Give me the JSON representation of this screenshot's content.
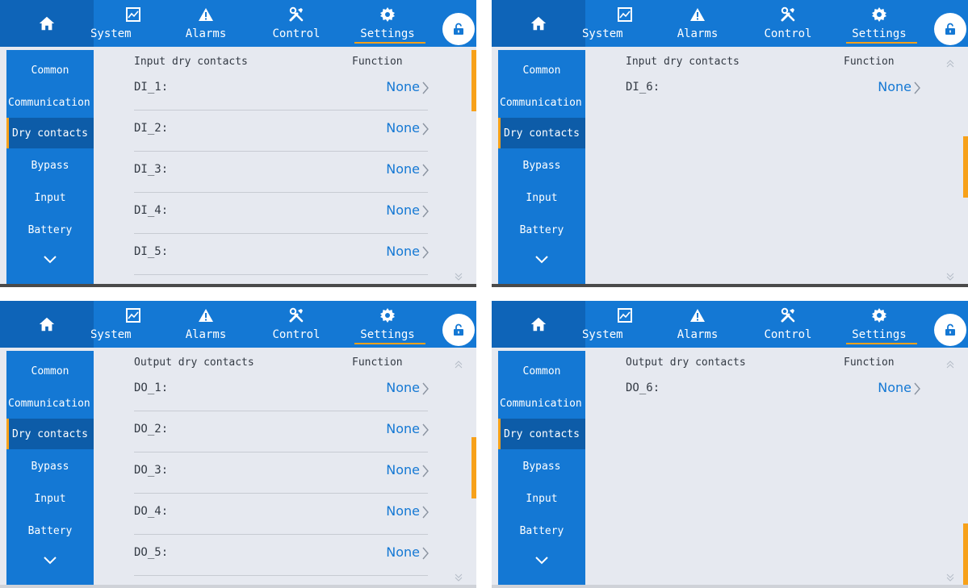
{
  "nav": {
    "home_icon": "home-icon",
    "tabs": [
      {
        "label": "System",
        "icon": "system-chart-icon"
      },
      {
        "label": "Alarms",
        "icon": "alarm-warning-icon"
      },
      {
        "label": "Control",
        "icon": "tools-icon"
      },
      {
        "label": "Settings",
        "icon": "gear-icon"
      }
    ],
    "lock_icon": "unlock-icon"
  },
  "sidebar": {
    "items": [
      "Common",
      "Communication",
      "Dry contacts",
      "Bypass",
      "Input",
      "Battery"
    ],
    "active": "Dry contacts",
    "more_icon": "chevron-down-icon"
  },
  "colors": {
    "accent": "#1478d4",
    "active_item": "#0d5ca8",
    "highlight": "#f7a11a",
    "background": "#e6e9f0"
  },
  "panels": [
    {
      "header_left": "Input dry contacts",
      "header_right": "Function",
      "rows": [
        {
          "name": "DI_1:",
          "value": "None"
        },
        {
          "name": "DI_2:",
          "value": "None"
        },
        {
          "name": "DI_3:",
          "value": "None"
        },
        {
          "name": "DI_4:",
          "value": "None"
        },
        {
          "name": "DI_5:",
          "value": "None"
        }
      ],
      "scroll_position": 0
    },
    {
      "header_left": "Input dry contacts",
      "header_right": "Function",
      "rows": [
        {
          "name": "DI_6:",
          "value": "None"
        }
      ],
      "scroll_position": 0.5
    },
    {
      "header_left": "Output dry contacts",
      "header_right": "Function",
      "rows": [
        {
          "name": "DO_1:",
          "value": "None"
        },
        {
          "name": "DO_2:",
          "value": "None"
        },
        {
          "name": "DO_3:",
          "value": "None"
        },
        {
          "name": "DO_4:",
          "value": "None"
        },
        {
          "name": "DO_5:",
          "value": "None"
        }
      ],
      "scroll_position": 0.5
    },
    {
      "header_left": "Output dry contacts",
      "header_right": "Function",
      "rows": [
        {
          "name": "DO_6:",
          "value": "None"
        }
      ],
      "scroll_position": 1
    }
  ]
}
